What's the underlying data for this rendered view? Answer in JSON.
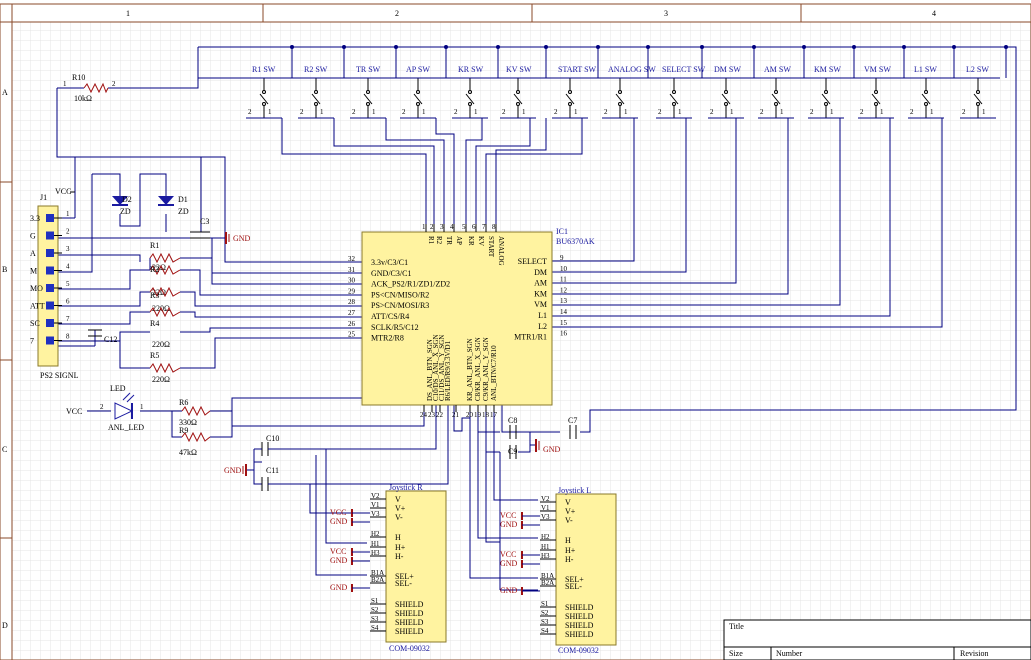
{
  "frame": {
    "columns": [
      "1",
      "2",
      "3",
      "4"
    ],
    "rows": [
      "A",
      "B",
      "C",
      "D"
    ]
  },
  "title_block": {
    "title": "Title",
    "size": "Size",
    "number": "Number",
    "revision": "Revision"
  },
  "switches": [
    {
      "label": "R1 SW"
    },
    {
      "label": "R2 SW"
    },
    {
      "label": "TR SW"
    },
    {
      "label": "AP SW"
    },
    {
      "label": "KR SW"
    },
    {
      "label": "KV SW"
    },
    {
      "label": "START SW"
    },
    {
      "label": "ANALOG SW"
    },
    {
      "label": "SELECT SW"
    },
    {
      "label": "DM SW"
    },
    {
      "label": "AM SW"
    },
    {
      "label": "KM SW"
    },
    {
      "label": "VM SW"
    },
    {
      "label": "L1 SW"
    },
    {
      "label": "L2 SW"
    }
  ],
  "switch_pins": {
    "a": "2",
    "b": "1"
  },
  "r10": {
    "ref": "R10",
    "value": "10kΩ",
    "pin1": "1",
    "pin2": "2"
  },
  "connector": {
    "ref": "J1",
    "name": "PS2 SIGNL",
    "vcc": "VCC",
    "pins": [
      {
        "label": "3.3",
        "num": "1"
      },
      {
        "label": "G",
        "num": "2"
      },
      {
        "label": "A",
        "num": "3"
      },
      {
        "label": "M",
        "num": "4"
      },
      {
        "label": "MO",
        "num": "5"
      },
      {
        "label": "ATT",
        "num": "6"
      },
      {
        "label": "SC",
        "num": "7"
      },
      {
        "label": "7",
        "num": "8"
      }
    ]
  },
  "zeners": [
    {
      "ref": "D2",
      "val": "ZD"
    },
    {
      "ref": "D1",
      "val": "ZD"
    }
  ],
  "c3": "C3",
  "c12": "C12",
  "gnd": "GND",
  "vcc": "VCC",
  "resistors": [
    {
      "ref": "R1",
      "val": "22Ω"
    },
    {
      "ref": "R2",
      "val": "22Ω"
    },
    {
      "ref": "R3",
      "val": "220Ω"
    },
    {
      "ref": "R4",
      "val": "220Ω"
    },
    {
      "ref": "R5",
      "val": "220Ω"
    }
  ],
  "ic": {
    "ref": "IC1",
    "part": "BU6370AK",
    "top_pins": [
      {
        "name": "R1",
        "num": "1"
      },
      {
        "name": "R2",
        "num": "2"
      },
      {
        "name": "TR",
        "num": "3"
      },
      {
        "name": "AP",
        "num": "4"
      },
      {
        "name": "KR",
        "num": "5"
      },
      {
        "name": "KV",
        "num": "6"
      },
      {
        "name": "START",
        "num": "7"
      },
      {
        "name": "ANALOG",
        "num": "8"
      }
    ],
    "left_pins": [
      {
        "name": "3.3v/C3/C1",
        "num": "32"
      },
      {
        "name": "GND/C3/C1",
        "num": "31"
      },
      {
        "name": "ACK_PS2/R1/ZD1/ZD2",
        "num": "30"
      },
      {
        "name": "PS<CN/MISO/R2",
        "num": "29"
      },
      {
        "name": "PS>CN/MOSI/R3",
        "num": "28"
      },
      {
        "name": "ATT/CS/R4",
        "num": "27"
      },
      {
        "name": "SCLK/R5/C12",
        "num": "26"
      },
      {
        "name": "MTR2/R8",
        "num": "25"
      }
    ],
    "right_pins": [
      {
        "name": "SELECT",
        "num": "9"
      },
      {
        "name": "DM",
        "num": "10"
      },
      {
        "name": "AM",
        "num": "11"
      },
      {
        "name": "KM",
        "num": "12"
      },
      {
        "name": "VM",
        "num": "13"
      },
      {
        "name": "L1",
        "num": "14"
      },
      {
        "name": "L2",
        "num": "15"
      },
      {
        "name": "MTR1/R1",
        "num": "16"
      }
    ],
    "bottom_pins": [
      {
        "name": "DS_ANL_BTN_SGN",
        "num": "24"
      },
      {
        "name": "C10/DS_ANL_X_SGN",
        "num": "23"
      },
      {
        "name": "C11/DS_ANL_Y_SGN",
        "num": "22"
      },
      {
        "name": "R6/LED/R9/3.3V/D1",
        "num": "21"
      },
      {
        "name": "KR_ANL_BTN_SGN",
        "num": "20"
      },
      {
        "name": "C8/KR_ANL_X_SGN",
        "num": "19"
      },
      {
        "name": "C9/KR_ANL_Y_SGN",
        "num": "18"
      },
      {
        "name": "ANL_BTN/C7/R10",
        "num": "17"
      }
    ]
  },
  "led": {
    "ref": "LED",
    "name": "ANL_LED",
    "vcc": "VCC",
    "p1": "2",
    "p2": "1"
  },
  "r6": {
    "ref": "R6",
    "val": "330Ω"
  },
  "r9": {
    "ref": "R9",
    "val": "47kΩ"
  },
  "caps": {
    "c10": "C10",
    "c11": "C11",
    "c8": "C8",
    "c9": "C9",
    "c7": "C7"
  },
  "joystick_r": {
    "title": "Joystick R",
    "part": "COM-09032",
    "pins": [
      {
        "num": "V2",
        "name": "V"
      },
      {
        "num": "V1",
        "name": "V+"
      },
      {
        "num": "V3",
        "name": "V-"
      },
      {
        "num": "H2",
        "name": "H"
      },
      {
        "num": "H1",
        "name": "H+"
      },
      {
        "num": "H3",
        "name": "H-"
      },
      {
        "num": "B1A",
        "name": "SEL+"
      },
      {
        "num": "B2A",
        "name": "SEL-"
      },
      {
        "num": "S1",
        "name": "SHIELD"
      },
      {
        "num": "S2",
        "name": "SHIELD"
      },
      {
        "num": "S3",
        "name": "SHIELD"
      },
      {
        "num": "S4",
        "name": "SHIELD"
      }
    ]
  },
  "joystick_l": {
    "title": "Joystick L",
    "part": "COM-09032",
    "pins": [
      {
        "num": "V2",
        "name": "V"
      },
      {
        "num": "V1",
        "name": "V+"
      },
      {
        "num": "V3",
        "name": "V-"
      },
      {
        "num": "H2",
        "name": "H"
      },
      {
        "num": "H1",
        "name": "H+"
      },
      {
        "num": "H3",
        "name": "H-"
      },
      {
        "num": "B1A",
        "name": "SEL+"
      },
      {
        "num": "B2A",
        "name": "SEL-"
      },
      {
        "num": "S1",
        "name": "SHIELD"
      },
      {
        "num": "S2",
        "name": "SHIELD"
      },
      {
        "num": "S3",
        "name": "SHIELD"
      },
      {
        "num": "S4",
        "name": "SHIELD"
      }
    ]
  }
}
